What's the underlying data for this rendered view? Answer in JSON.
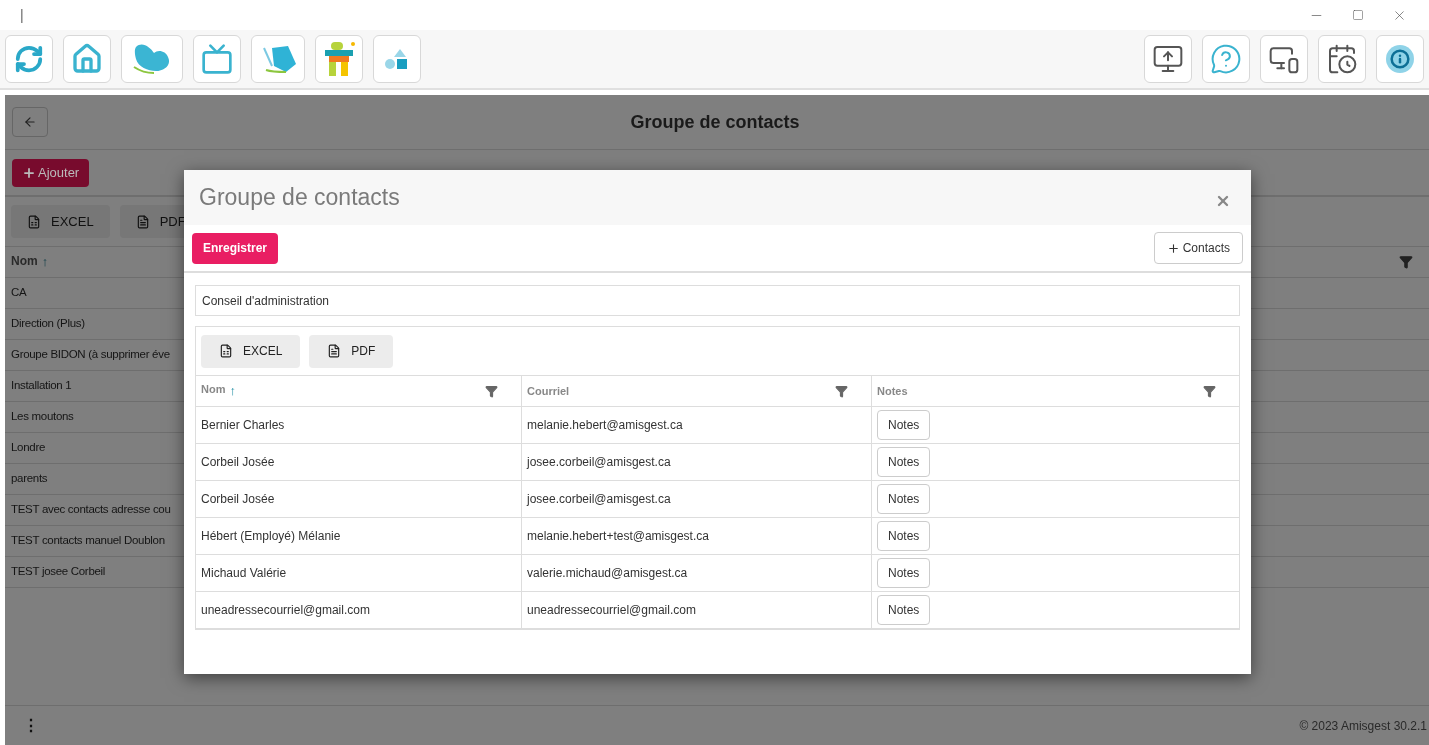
{
  "window": {
    "title": "|"
  },
  "page": {
    "title": "Groupe de contacts",
    "add_button": "Ajouter",
    "exports": [
      "EXCEL",
      "PDF"
    ],
    "column": {
      "label": "Nom",
      "sort_mark": "↑"
    },
    "rows": [
      "CA",
      "Direction (Plus)",
      "Groupe BIDON (à supprimer éve",
      "Installation 1",
      "Les moutons",
      "Londre",
      "parents",
      "TEST avec contacts adresse cou",
      "TEST contacts manuel Doublon",
      "TEST josee Corbeil"
    ]
  },
  "dialog": {
    "title": "Groupe de contacts",
    "save_button": "Enregistrer",
    "add_contacts_button": "Contacts",
    "name_field": {
      "value": "Conseil d'administration"
    },
    "exports": [
      "EXCEL",
      "PDF"
    ],
    "columns": [
      {
        "label": "Nom",
        "sort_mark": "↑"
      },
      {
        "label": "Courriel"
      },
      {
        "label": "Notes"
      }
    ],
    "rows": [
      {
        "nom": "Bernier Charles",
        "courriel": "melanie.hebert@amisgest.ca",
        "notes": "Notes"
      },
      {
        "nom": "Corbeil Josée",
        "courriel": "josee.corbeil@amisgest.ca",
        "notes": "Notes"
      },
      {
        "nom": "Corbeil Josée",
        "courriel": "josee.corbeil@amisgest.ca",
        "notes": "Notes"
      },
      {
        "nom": "Hébert (Employé) Mélanie",
        "courriel": "melanie.hebert+test@amisgest.ca",
        "notes": "Notes"
      },
      {
        "nom": "Michaud Valérie",
        "courriel": "valerie.michaud@amisgest.ca",
        "notes": "Notes"
      },
      {
        "nom": "uneadressecourriel@gmail.com",
        "courriel": "uneadressecourriel@gmail.com",
        "notes": "Notes"
      }
    ]
  },
  "footer": {
    "menu": "⋮",
    "copyright": "© 2023 Amisgest 30.2.1"
  }
}
